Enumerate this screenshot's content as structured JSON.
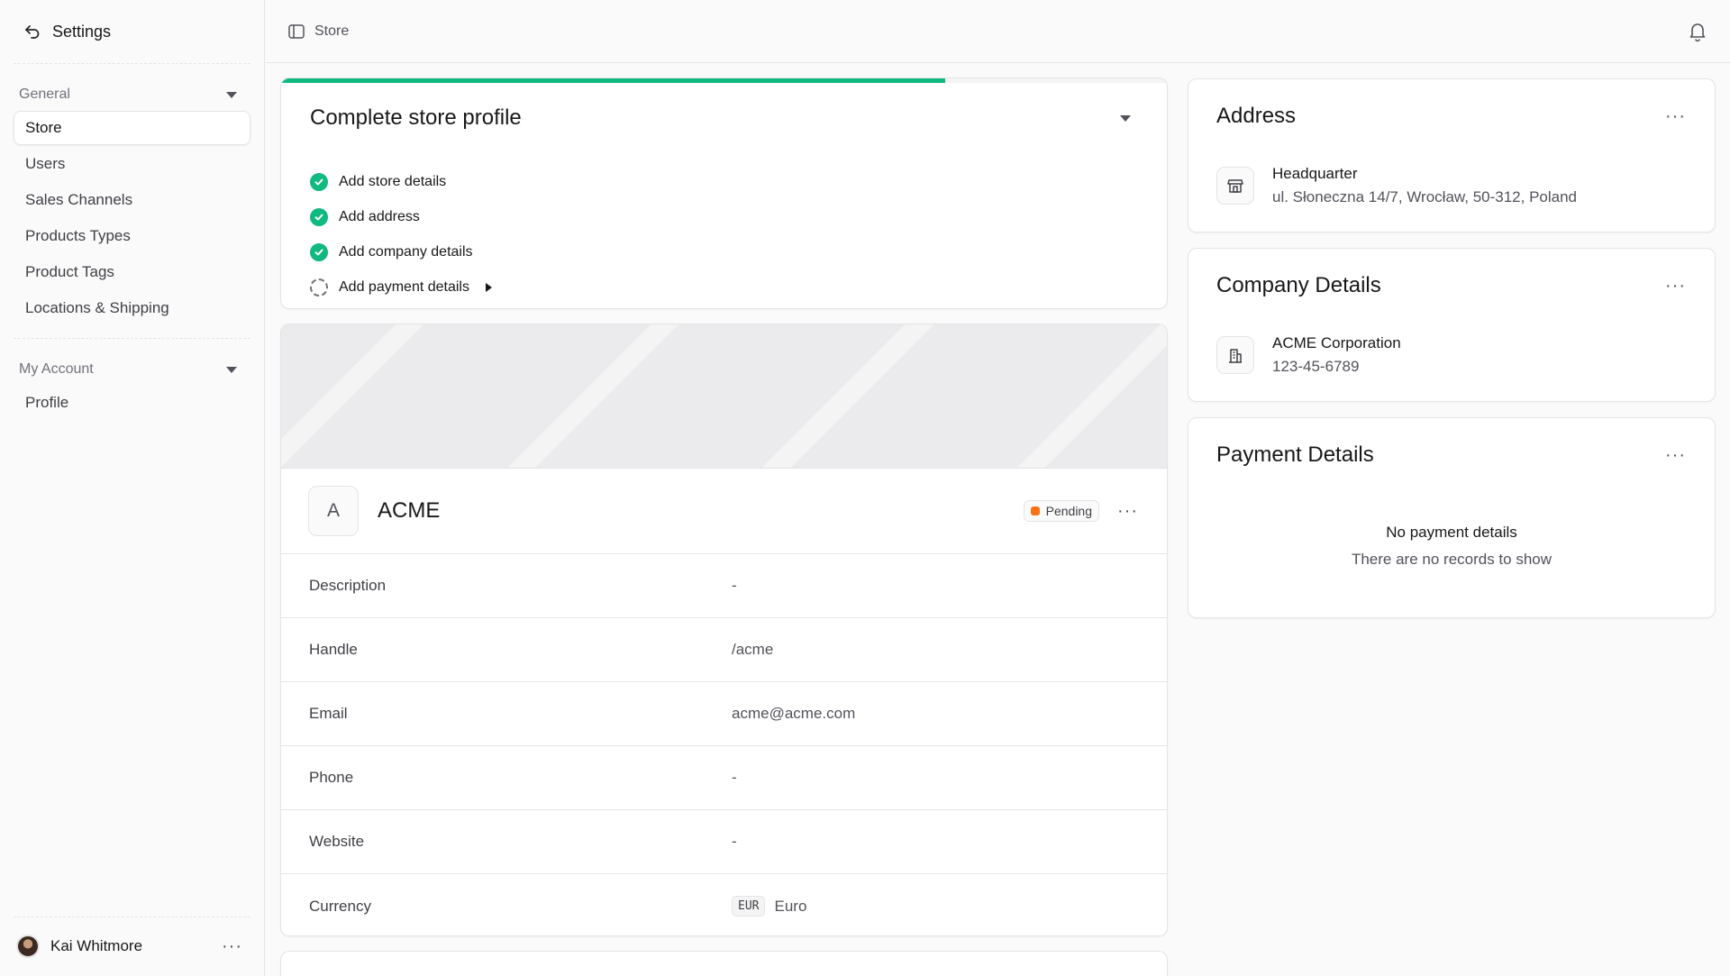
{
  "sidebar": {
    "header_label": "Settings",
    "sections": [
      {
        "title": "General",
        "items": [
          "Store",
          "Users",
          "Sales Channels",
          "Products Types",
          "Product Tags",
          "Locations & Shipping"
        ]
      },
      {
        "title": "My Account",
        "items": [
          "Profile"
        ]
      }
    ],
    "active_item": "Store",
    "user_name": "Kai Whitmore"
  },
  "topbar": {
    "breadcrumb": "Store"
  },
  "profile_checklist": {
    "title": "Complete store profile",
    "progress": 0.75,
    "items": [
      {
        "label": "Add store details",
        "done": true
      },
      {
        "label": "Add address",
        "done": true
      },
      {
        "label": "Add company details",
        "done": true
      },
      {
        "label": "Add payment details",
        "done": false
      }
    ]
  },
  "store": {
    "initial": "A",
    "name": "ACME",
    "status": "Pending",
    "status_color": "#f97316",
    "fields": [
      {
        "label": "Description",
        "value": "-"
      },
      {
        "label": "Handle",
        "value": "/acme"
      },
      {
        "label": "Email",
        "value": "acme@acme.com"
      },
      {
        "label": "Phone",
        "value": "-"
      },
      {
        "label": "Website",
        "value": "-"
      }
    ],
    "currency": {
      "label": "Currency",
      "code": "EUR",
      "name": "Euro"
    }
  },
  "address": {
    "title": "Address",
    "name": "Headquarter",
    "line": "ul. Słoneczna 14/7, Wrocław, 50-312, Poland"
  },
  "company": {
    "title": "Company Details",
    "name": "ACME Corporation",
    "id": "123-45-6789"
  },
  "payment": {
    "title": "Payment Details",
    "empty_title": "No payment details",
    "empty_sub": "There are no records to show"
  },
  "accent_color": "#10b981"
}
